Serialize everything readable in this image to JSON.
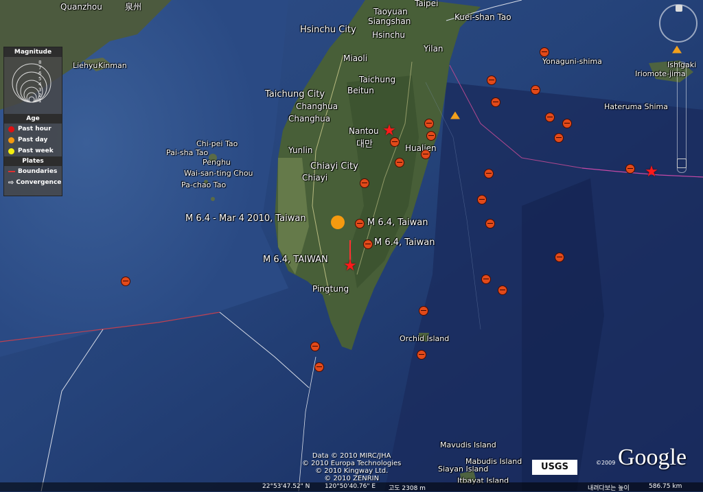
{
  "legend": {
    "magnitude_title": "Magnitude",
    "magnitude_scale": [
      "8",
      "7",
      "6",
      "5",
      "4",
      "3",
      "2",
      "1"
    ],
    "age_title": "Age",
    "age_items": [
      {
        "label": "Past hour",
        "color": "#e01010"
      },
      {
        "label": "Past day",
        "color": "#f59a10"
      },
      {
        "label": "Past week",
        "color": "#f5ef10"
      }
    ],
    "plates_title": "Plates",
    "plates_items": [
      {
        "label": "Boundaries",
        "icon": "red-line-icon"
      },
      {
        "label": "Convergence",
        "icon": "arrow-right-icon"
      }
    ]
  },
  "places": [
    {
      "name": "Quanzhou"
    },
    {
      "name": "泉州"
    },
    {
      "name": "Taoyuan"
    },
    {
      "name": "Taipei"
    },
    {
      "name": "Siangshan"
    },
    {
      "name": "Hsinchu City"
    },
    {
      "name": "Hsinchu"
    },
    {
      "name": "Kuei-shan Tao"
    },
    {
      "name": "Miaoli"
    },
    {
      "name": "Yilan"
    },
    {
      "name": "Taichung"
    },
    {
      "name": "Beitun"
    },
    {
      "name": "Taichung City"
    },
    {
      "name": "Changhua"
    },
    {
      "name": "Changhua"
    },
    {
      "name": "Nantou"
    },
    {
      "name": "대만"
    },
    {
      "name": "Hualien"
    },
    {
      "name": "Yunlin"
    },
    {
      "name": "Chiayi City"
    },
    {
      "name": "Chiayi"
    },
    {
      "name": "Chi-pei Tao"
    },
    {
      "name": "Pai-sha Tao"
    },
    {
      "name": "Penghu"
    },
    {
      "name": "Wai-san-ting Chou"
    },
    {
      "name": "Pa-chao Tao"
    },
    {
      "name": "Liehyu"
    },
    {
      "name": "Kinman"
    },
    {
      "name": "Pingtung"
    },
    {
      "name": "Orchid Island"
    },
    {
      "name": "Yonaguni-shima"
    },
    {
      "name": "Iriomote-jima"
    },
    {
      "name": "Ishigaki"
    },
    {
      "name": "Hateruma Shima"
    },
    {
      "name": "Mavudis Island"
    },
    {
      "name": "Mabudis Island"
    },
    {
      "name": "Siayan Island"
    },
    {
      "name": "Itbayat Island"
    }
  ],
  "quake_labels": [
    {
      "text": "M 6.4 - Mar  4 2010, Taiwan"
    },
    {
      "text": "M 6.4, Taiwan"
    },
    {
      "text": "M 6.4, Taiwan"
    },
    {
      "text": "M 6.4, TAIWAN"
    }
  ],
  "credits": [
    "Data © 2010 MIRC/JHA",
    "© 2010 Europa Technologies",
    "© 2010 Kingway Ltd.",
    "© 2010 ZENRIN"
  ],
  "logo_usgs": "USGS",
  "logo_google": "Google",
  "google_copyright": "©2009",
  "status": {
    "lat": "22°53'47.52\" N",
    "lon": "120°50'40.76\" E",
    "elev": "고도 2308 m",
    "eye_label": "내려다보는 높이",
    "eye_alt": "586.75 km"
  }
}
